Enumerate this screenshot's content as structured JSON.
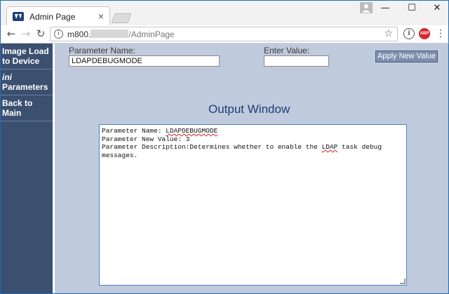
{
  "browser": {
    "tab": {
      "title": "Admin Page"
    },
    "address": {
      "host_prefix": "m800.",
      "path": "/AdminPage"
    },
    "window_controls": {
      "minimize": "—",
      "maximize": "☐",
      "close": "✕"
    },
    "nav": {
      "back": "←",
      "forward": "→",
      "reload": "↻"
    },
    "extensions": {
      "info_label": "i",
      "abp_label": "ABP"
    }
  },
  "sidebar": {
    "items": [
      {
        "line1": "Image Load",
        "line2": "to Device"
      },
      {
        "line1_italic": "ini",
        "line2": "Parameters"
      },
      {
        "line1": "Back to",
        "line2": "Main"
      }
    ]
  },
  "form": {
    "parameter_name_label": "Parameter Name:",
    "parameter_name_value": "LDAPDEBUGMODE",
    "enter_value_label": "Enter Value:",
    "enter_value_value": "",
    "apply_button": "Apply New Value"
  },
  "output": {
    "title": "Output Window",
    "name_prefix": "Parameter Name: ",
    "name_value": "LDAPDEBUGMODE",
    "new_value_line": "Parameter New Value: 3",
    "desc_prefix": "Parameter Description:Determines whether to enable the ",
    "desc_ldap": "LDAP",
    "desc_suffix": " task debug messages."
  }
}
